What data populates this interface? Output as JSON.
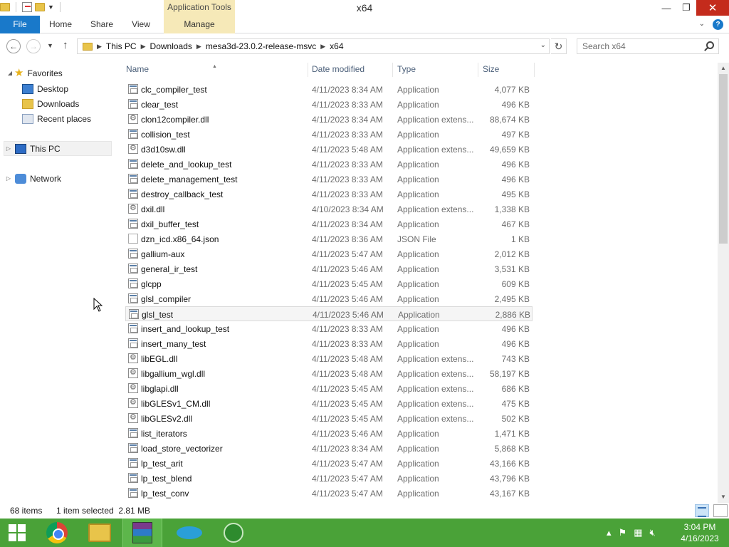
{
  "window": {
    "title": "x64",
    "context_tab_header": "Application Tools",
    "controls": {
      "minimize": "—",
      "maximize": "❐",
      "close": "✕"
    }
  },
  "ribbon": {
    "tabs": [
      "File",
      "Home",
      "Share",
      "View",
      "Manage"
    ],
    "help": "?"
  },
  "address": {
    "crumbs": [
      "This PC",
      "Downloads",
      "mesa3d-23.0.2-release-msvc",
      "x64"
    ],
    "search_placeholder": "Search x64"
  },
  "nav": {
    "favorites": "Favorites",
    "favorite_items": [
      "Desktop",
      "Downloads",
      "Recent places"
    ],
    "this_pc": "This PC",
    "network": "Network"
  },
  "columns": {
    "name": "Name",
    "date": "Date modified",
    "type": "Type",
    "size": "Size"
  },
  "files": [
    {
      "name": "clc_compiler_test",
      "date": "4/11/2023 8:34 AM",
      "type": "Application",
      "size": "4,077 KB",
      "icon": "app"
    },
    {
      "name": "clear_test",
      "date": "4/11/2023 8:33 AM",
      "type": "Application",
      "size": "496 KB",
      "icon": "app"
    },
    {
      "name": "clon12compiler.dll",
      "date": "4/11/2023 8:34 AM",
      "type": "Application extens...",
      "size": "88,674 KB",
      "icon": "dll"
    },
    {
      "name": "collision_test",
      "date": "4/11/2023 8:33 AM",
      "type": "Application",
      "size": "497 KB",
      "icon": "app"
    },
    {
      "name": "d3d10sw.dll",
      "date": "4/11/2023 5:48 AM",
      "type": "Application extens...",
      "size": "49,659 KB",
      "icon": "dll"
    },
    {
      "name": "delete_and_lookup_test",
      "date": "4/11/2023 8:33 AM",
      "type": "Application",
      "size": "496 KB",
      "icon": "app"
    },
    {
      "name": "delete_management_test",
      "date": "4/11/2023 8:33 AM",
      "type": "Application",
      "size": "496 KB",
      "icon": "app"
    },
    {
      "name": "destroy_callback_test",
      "date": "4/11/2023 8:33 AM",
      "type": "Application",
      "size": "495 KB",
      "icon": "app"
    },
    {
      "name": "dxil.dll",
      "date": "4/10/2023 8:34 AM",
      "type": "Application extens...",
      "size": "1,338 KB",
      "icon": "dll"
    },
    {
      "name": "dxil_buffer_test",
      "date": "4/11/2023 8:34 AM",
      "type": "Application",
      "size": "467 KB",
      "icon": "app"
    },
    {
      "name": "dzn_icd.x86_64.json",
      "date": "4/11/2023 8:36 AM",
      "type": "JSON File",
      "size": "1 KB",
      "icon": "json"
    },
    {
      "name": "gallium-aux",
      "date": "4/11/2023 5:47 AM",
      "type": "Application",
      "size": "2,012 KB",
      "icon": "app"
    },
    {
      "name": "general_ir_test",
      "date": "4/11/2023 5:46 AM",
      "type": "Application",
      "size": "3,531 KB",
      "icon": "app"
    },
    {
      "name": "glcpp",
      "date": "4/11/2023 5:45 AM",
      "type": "Application",
      "size": "609 KB",
      "icon": "app"
    },
    {
      "name": "glsl_compiler",
      "date": "4/11/2023 5:46 AM",
      "type": "Application",
      "size": "2,495 KB",
      "icon": "app"
    },
    {
      "name": "glsl_test",
      "date": "4/11/2023 5:46 AM",
      "type": "Application",
      "size": "2,886 KB",
      "icon": "app",
      "selected": true
    },
    {
      "name": "insert_and_lookup_test",
      "date": "4/11/2023 8:33 AM",
      "type": "Application",
      "size": "496 KB",
      "icon": "app"
    },
    {
      "name": "insert_many_test",
      "date": "4/11/2023 8:33 AM",
      "type": "Application",
      "size": "496 KB",
      "icon": "app"
    },
    {
      "name": "libEGL.dll",
      "date": "4/11/2023 5:48 AM",
      "type": "Application extens...",
      "size": "743 KB",
      "icon": "dll"
    },
    {
      "name": "libgallium_wgl.dll",
      "date": "4/11/2023 5:48 AM",
      "type": "Application extens...",
      "size": "58,197 KB",
      "icon": "dll"
    },
    {
      "name": "libglapi.dll",
      "date": "4/11/2023 5:45 AM",
      "type": "Application extens...",
      "size": "686 KB",
      "icon": "dll"
    },
    {
      "name": "libGLESv1_CM.dll",
      "date": "4/11/2023 5:45 AM",
      "type": "Application extens...",
      "size": "475 KB",
      "icon": "dll"
    },
    {
      "name": "libGLESv2.dll",
      "date": "4/11/2023 5:45 AM",
      "type": "Application extens...",
      "size": "502 KB",
      "icon": "dll"
    },
    {
      "name": "list_iterators",
      "date": "4/11/2023 5:46 AM",
      "type": "Application",
      "size": "1,471 KB",
      "icon": "app"
    },
    {
      "name": "load_store_vectorizer",
      "date": "4/11/2023 8:34 AM",
      "type": "Application",
      "size": "5,868 KB",
      "icon": "app"
    },
    {
      "name": "lp_test_arit",
      "date": "4/11/2023 5:47 AM",
      "type": "Application",
      "size": "43,166 KB",
      "icon": "app"
    },
    {
      "name": "lp_test_blend",
      "date": "4/11/2023 5:47 AM",
      "type": "Application",
      "size": "43,796 KB",
      "icon": "app"
    },
    {
      "name": "lp_test_conv",
      "date": "4/11/2023 5:47 AM",
      "type": "Application",
      "size": "43,167 KB",
      "icon": "app"
    }
  ],
  "status": {
    "count": "68 items",
    "selection": "1 item selected  2.81 MB"
  },
  "taskbar": {
    "apps": [
      "start",
      "chrome",
      "file-explorer",
      "winrar",
      "dolphin",
      "bug-app"
    ],
    "time": "3:04 PM",
    "date": "4/16/2023"
  },
  "colors": {
    "accent": "#1979ca",
    "taskbar": "#4aa238",
    "context_tab": "#f6e9b8"
  }
}
